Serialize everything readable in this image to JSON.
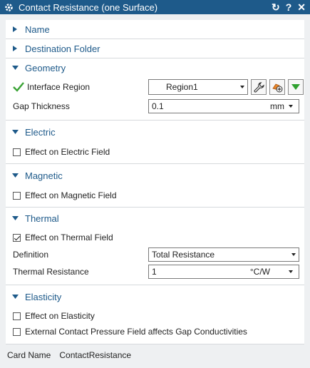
{
  "window": {
    "title": "Contact Resistance (one Surface)",
    "reset_icon": "↻",
    "help_icon": "?",
    "close_icon": "✕"
  },
  "sections": {
    "name": {
      "label": "Name"
    },
    "destination": {
      "label": "Destination Folder"
    },
    "geometry": {
      "label": "Geometry",
      "interface_label": "Interface Region",
      "interface_value": "Region1",
      "gap_label": "Gap Thickness",
      "gap_value": "0.1",
      "gap_unit": "mm"
    },
    "electric": {
      "label": "Electric",
      "effect_label": "Effect on Electric Field",
      "checked": false
    },
    "magnetic": {
      "label": "Magnetic",
      "effect_label": "Effect on Magnetic Field",
      "checked": false
    },
    "thermal": {
      "label": "Thermal",
      "effect_label": "Effect on Thermal Field",
      "checked": true,
      "definition_label": "Definition",
      "definition_value": "Total Resistance",
      "resistance_label": "Thermal Resistance",
      "resistance_value": "1",
      "resistance_unit": "°C/W"
    },
    "elasticity": {
      "label": "Elasticity",
      "effect_label": "Effect on Elasticity",
      "effect_checked": false,
      "pressure_label": "External Contact Pressure Field affects Gap Conductivities",
      "pressure_checked": false
    }
  },
  "footer": {
    "card_name_label": "Card Name",
    "card_name_value": "ContactResistance"
  },
  "colors": {
    "title_bar": "#1e5a8a",
    "section_text": "#1e5a8a",
    "check_green": "#3aa335"
  }
}
